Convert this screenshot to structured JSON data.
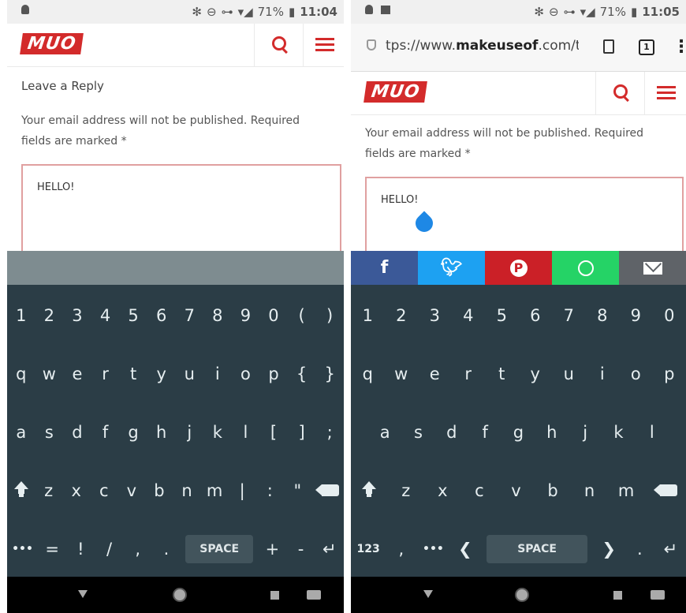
{
  "left": {
    "status": {
      "battery": "71%",
      "time": "11:04"
    },
    "site": {
      "logo": "MUO"
    },
    "reply_title": "Leave a Reply",
    "notice_line1": "Your email address will not be published. Required",
    "notice_line2": "fields are marked *",
    "comment_text": "HELLO!",
    "keyboard": {
      "row1": [
        "1",
        "2",
        "3",
        "4",
        "5",
        "6",
        "7",
        "8",
        "9",
        "0",
        "(",
        ")"
      ],
      "row2": [
        "q",
        "w",
        "e",
        "r",
        "t",
        "y",
        "u",
        "i",
        "o",
        "p",
        "{",
        "}"
      ],
      "row3": [
        "a",
        "s",
        "d",
        "f",
        "g",
        "h",
        "j",
        "k",
        "l",
        "[",
        "]",
        ";"
      ],
      "row4": [
        "z",
        "x",
        "c",
        "v",
        "b",
        "n",
        "m",
        "|",
        ":",
        "\""
      ],
      "row5_pre": [
        "•••",
        "=",
        "!",
        "/",
        ",",
        "."
      ],
      "space": "SPACE",
      "row5_post": [
        "+",
        "-",
        "↵"
      ]
    }
  },
  "right": {
    "status": {
      "battery": "71%",
      "time": "11:05"
    },
    "url": {
      "prefix": "tps://www.",
      "domain": "makeuseof",
      "suffix": ".com/ta"
    },
    "tab_count": "1",
    "site": {
      "logo": "MUO"
    },
    "notice_line1": "Your email address will not be published. Required",
    "notice_line2": "fields are marked *",
    "comment_text": "HELLO!",
    "share": {
      "facebook": "f"
    },
    "keyboard": {
      "row1": [
        "1",
        "2",
        "3",
        "4",
        "5",
        "6",
        "7",
        "8",
        "9",
        "0"
      ],
      "row2": [
        "q",
        "w",
        "e",
        "r",
        "t",
        "y",
        "u",
        "i",
        "o",
        "p"
      ],
      "row3": [
        "a",
        "s",
        "d",
        "f",
        "g",
        "h",
        "j",
        "k",
        "l"
      ],
      "row4": [
        "z",
        "x",
        "c",
        "v",
        "b",
        "n",
        "m"
      ],
      "row5_pre": [
        "123",
        ",",
        "•••",
        "❮"
      ],
      "space": "SPACE",
      "row5_post": [
        "❯",
        ".",
        "↵"
      ]
    }
  },
  "colors": {
    "brand": "#d32b2b",
    "keyboard_bg": "#2b3d46",
    "cursor": "#1e88e5"
  }
}
